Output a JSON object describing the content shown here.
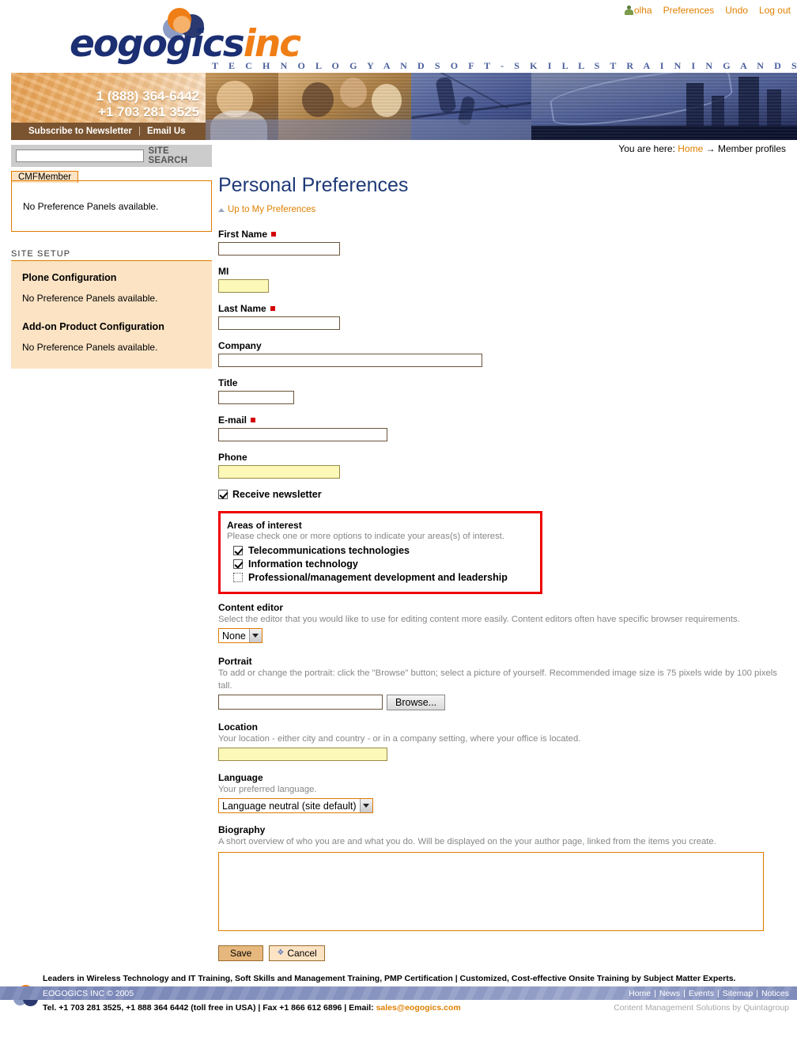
{
  "personal_bar": {
    "user_icon": "user-icon",
    "username": "olha",
    "preferences": "Preferences",
    "undo": "Undo",
    "logout": "Log out"
  },
  "logo": {
    "text_primary": "eogogics",
    "text_secondary": "inc",
    "tagline": "T E C H N O L O G Y   A N D   S O F T - S K I L L S   T R A I N I N G   A N D   S E R V I C E S"
  },
  "banner": {
    "phone_toll_free": "1 (888) 364-6442",
    "phone_direct": "+1 703 281 3525",
    "subscribe_link": "Subscribe to Newsletter",
    "separator": "|",
    "email_link": "Email Us"
  },
  "breadcrumb": {
    "prefix": "You are here:",
    "home": "Home",
    "arrow": "→",
    "current": "Member profiles"
  },
  "left_column": {
    "search_value": "",
    "search_placeholder": "",
    "search_label": "SITE SEARCH",
    "tab_label": "CMFMember",
    "panel_empty_message": "No Preference Panels available.",
    "site_setup_heading": "SITE SETUP",
    "sections": [
      {
        "title": "Plone Configuration",
        "note": "No Preference Panels available."
      },
      {
        "title": "Add-on Product Configuration",
        "note": "No Preference Panels available."
      }
    ]
  },
  "main": {
    "page_title": "Personal Preferences",
    "up_link": "Up to My Preferences",
    "fields": {
      "first_name": {
        "label": "First Name",
        "required": true,
        "value": ""
      },
      "mi": {
        "label": "MI",
        "required": false,
        "value": ""
      },
      "last_name": {
        "label": "Last Name",
        "required": true,
        "value": ""
      },
      "company": {
        "label": "Company",
        "required": false,
        "value": ""
      },
      "title": {
        "label": "Title",
        "required": false,
        "value": ""
      },
      "email": {
        "label": "E-mail",
        "required": true,
        "value": ""
      },
      "phone": {
        "label": "Phone",
        "required": false,
        "value": ""
      },
      "newsletter": {
        "label": "Receive newsletter",
        "checked": true
      }
    },
    "areas_of_interest": {
      "title": "Areas of interest",
      "help": "Please check one or more options to indicate your areas(s) of interest.",
      "highlight_color": "#ee0000",
      "options": [
        {
          "label": "Telecommunications technologies",
          "checked": true
        },
        {
          "label": "Information technology",
          "checked": true
        },
        {
          "label": "Professional/management development and leadership",
          "checked": false
        }
      ]
    },
    "content_editor": {
      "label": "Content editor",
      "help": "Select the editor that you would like to use for editing content more easily. Content editors often have specific browser requirements.",
      "selected": "None"
    },
    "portrait": {
      "label": "Portrait",
      "help": "To add or change the portrait: click the \"Browse\" button; select a picture of yourself. Recommended image size is 75 pixels wide by 100 pixels tall.",
      "file_value": "",
      "browse_label": "Browse..."
    },
    "location": {
      "label": "Location",
      "help": "Your location - either city and country - or in a company setting, where your office is located.",
      "value": ""
    },
    "language": {
      "label": "Language",
      "help": "Your preferred language.",
      "selected": "Language neutral (site default)"
    },
    "biography": {
      "label": "Biography",
      "help": "A short overview of who you are and what you do. Will be displayed on the your author page, linked from the items you create.",
      "value": ""
    },
    "buttons": {
      "save": "Save",
      "cancel": "Cancel"
    }
  },
  "footer": {
    "tagline": "Leaders in Wireless Technology and IT Training, Soft Skills and Management Training, PMP Certification | Customized, Cost-effective Onsite Training by Subject Matter Experts.",
    "copyright": "EOGOGICS INC © 2005",
    "nav": [
      "Home",
      "News",
      "Events",
      "Sitemap",
      "Notices"
    ],
    "contact_prefix": "Tel. +1 703 281 3525, +1 888 364 6442 (toll free in USA) | Fax +1 866 612 6896 | Email: ",
    "contact_email": "sales@eogogics.com",
    "credit": "Content Management Solutions by Quintagroup"
  },
  "colors": {
    "brand_orange": "#e07b00",
    "brand_navy": "#1f3a78",
    "highlight_red": "#ee0000",
    "required_red": "#d40000",
    "yellow_field": "#fcf8b8",
    "panel_peach": "#fbe3c4"
  }
}
